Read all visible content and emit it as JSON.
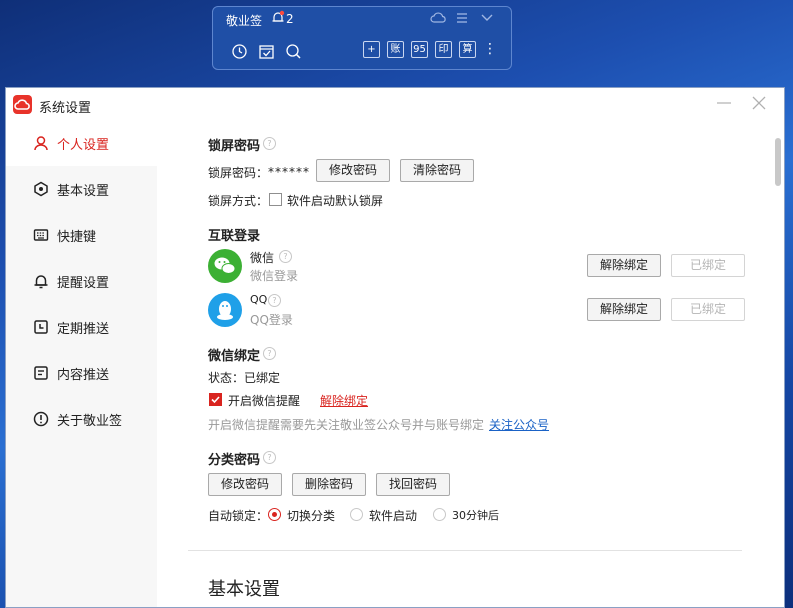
{
  "widget": {
    "title": "敬业签",
    "notification_count": "2",
    "tools": [
      "账",
      "95",
      "印",
      "算"
    ],
    "more": "⋮"
  },
  "window": {
    "title": "系统设置"
  },
  "sidebar": {
    "items": [
      {
        "label": "个人设置",
        "active": true
      },
      {
        "label": "基本设置"
      },
      {
        "label": "快捷键"
      },
      {
        "label": "提醒设置"
      },
      {
        "label": "定期推送"
      },
      {
        "label": "内容推送"
      },
      {
        "label": "关于敬业签"
      }
    ]
  },
  "lock": {
    "title": "锁屏密码",
    "help": "?",
    "label": "锁屏密码：",
    "value": "******",
    "change_btn": "修改密码",
    "clear_btn": "清除密码",
    "mode_label": "锁屏方式：",
    "mode_option": "软件启动默认锁屏"
  },
  "login": {
    "title": "互联登录",
    "wechat": {
      "name": "微信",
      "sub": "微信登录",
      "unbind": "解除绑定",
      "status": "已绑定"
    },
    "qq": {
      "name": "QQ",
      "sub": "QQ登录",
      "unbind": "解除绑定",
      "status": "已绑定"
    }
  },
  "wx_bind": {
    "title": "微信绑定",
    "status_label": "状态：",
    "status_value": "已绑定",
    "reminder": "开启微信提醒",
    "unbind_link": "解除绑定",
    "note": "开启微信提醒需要先关注敬业签公众号并与账号绑定",
    "follow_link": "关注公众号"
  },
  "category": {
    "title": "分类密码",
    "buttons": [
      "修改密码",
      "删除密码",
      "找回密码"
    ],
    "auto_label": "自动锁定：",
    "options": [
      "切换分类",
      "软件启动",
      "30分钟后"
    ],
    "selected": "切换分类"
  },
  "next_section": {
    "title": "基本设置"
  },
  "colors": {
    "accent": "#d9241f",
    "link": "#1a62c6",
    "wechat": "#3cb034",
    "qq": "#1fa0e8"
  }
}
